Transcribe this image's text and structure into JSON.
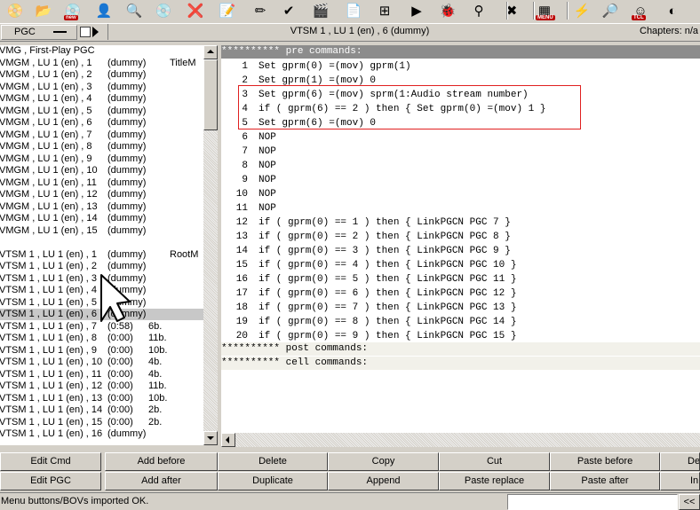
{
  "toolbar": {
    "icons": [
      {
        "name": "open-disc-icon",
        "glyph": "📀",
        "badge": ""
      },
      {
        "name": "open-folder-icon",
        "glyph": "📂",
        "badge": ""
      },
      {
        "name": "new-disc-icon",
        "glyph": "💿",
        "badge": "new"
      },
      {
        "name": "user-icon",
        "glyph": "👤",
        "badge": ""
      },
      {
        "name": "search-icon",
        "glyph": "🔍",
        "badge": ""
      },
      {
        "name": "disc-tools-icon",
        "glyph": "💿",
        "badge": ""
      },
      {
        "name": "remove-icon",
        "glyph": "❌",
        "badge": ""
      },
      {
        "name": "notepad-icon",
        "glyph": "📝",
        "badge": ""
      },
      {
        "name": "edit-icon",
        "glyph": "✏",
        "badge": ""
      },
      {
        "name": "check-disc-icon",
        "glyph": "✔",
        "badge": ""
      },
      {
        "name": "video-icon",
        "glyph": "🎬",
        "badge": ""
      },
      {
        "name": "document-icon",
        "glyph": "📄",
        "badge": ""
      },
      {
        "name": "grid-icon",
        "glyph": "⊞",
        "badge": ""
      },
      {
        "name": "play-icon",
        "glyph": "▶",
        "badge": ""
      },
      {
        "name": "bug-icon",
        "glyph": "🐞",
        "badge": ""
      },
      {
        "name": "tree-icon",
        "glyph": "⚲",
        "badge": ""
      },
      {
        "name": "delete-icon",
        "glyph": "✖",
        "badge": ""
      },
      {
        "name": "menu-icon",
        "glyph": "▦",
        "badge": "MENU"
      },
      {
        "name": "wand-icon",
        "glyph": "⚡",
        "badge": ""
      },
      {
        "name": "numbers-search-icon",
        "glyph": "🔎",
        "badge": ""
      },
      {
        "name": "tcl-icon",
        "glyph": "☺",
        "badge": "TCL"
      },
      {
        "name": "more-icon",
        "glyph": "◐",
        "badge": ""
      }
    ]
  },
  "header": {
    "pgc_label": "PGC",
    "title": "VTSM 1 , LU 1 (en) , 6  (dummy)",
    "chapters": "Chapters: n/a"
  },
  "list": {
    "items": [
      {
        "c1": "VMG , First-Play PGC",
        "c2": "",
        "c3": "",
        "c4": ""
      },
      {
        "c1": "VMGM , LU 1 (en) , 1",
        "c2": "(dummy)",
        "c3": "",
        "c4": "TitleM"
      },
      {
        "c1": "VMGM , LU 1 (en) , 2",
        "c2": "(dummy)",
        "c3": "",
        "c4": ""
      },
      {
        "c1": "VMGM , LU 1 (en) , 3",
        "c2": "(dummy)",
        "c3": "",
        "c4": ""
      },
      {
        "c1": "VMGM , LU 1 (en) , 4",
        "c2": "(dummy)",
        "c3": "",
        "c4": ""
      },
      {
        "c1": "VMGM , LU 1 (en) , 5",
        "c2": "(dummy)",
        "c3": "",
        "c4": ""
      },
      {
        "c1": "VMGM , LU 1 (en) , 6",
        "c2": "(dummy)",
        "c3": "",
        "c4": ""
      },
      {
        "c1": "VMGM , LU 1 (en) , 7",
        "c2": "(dummy)",
        "c3": "",
        "c4": ""
      },
      {
        "c1": "VMGM , LU 1 (en) , 8",
        "c2": "(dummy)",
        "c3": "",
        "c4": ""
      },
      {
        "c1": "VMGM , LU 1 (en) , 9",
        "c2": "(dummy)",
        "c3": "",
        "c4": ""
      },
      {
        "c1": "VMGM , LU 1 (en) , 10",
        "c2": "(dummy)",
        "c3": "",
        "c4": ""
      },
      {
        "c1": "VMGM , LU 1 (en) , 11",
        "c2": "(dummy)",
        "c3": "",
        "c4": ""
      },
      {
        "c1": "VMGM , LU 1 (en) , 12",
        "c2": "(dummy)",
        "c3": "",
        "c4": ""
      },
      {
        "c1": "VMGM , LU 1 (en) , 13",
        "c2": "(dummy)",
        "c3": "",
        "c4": ""
      },
      {
        "c1": "VMGM , LU 1 (en) , 14",
        "c2": "(dummy)",
        "c3": "",
        "c4": ""
      },
      {
        "c1": "VMGM , LU 1 (en) , 15",
        "c2": "(dummy)",
        "c3": "",
        "c4": ""
      },
      {
        "c1": "",
        "c2": "",
        "c3": "",
        "c4": ""
      },
      {
        "c1": "VTSM 1 , LU 1 (en) , 1",
        "c2": "(dummy)",
        "c3": "",
        "c4": "RootM"
      },
      {
        "c1": "VTSM 1 , LU 1 (en) , 2",
        "c2": "(dummy)",
        "c3": "",
        "c4": ""
      },
      {
        "c1": "VTSM 1 , LU 1 (en) , 3",
        "c2": "(dummy)",
        "c3": "",
        "c4": ""
      },
      {
        "c1": "VTSM 1 , LU 1 (en) , 4",
        "c2": "(dummy)",
        "c3": "",
        "c4": ""
      },
      {
        "c1": "VTSM 1 , LU 1 (en) , 5",
        "c2": "(dummy)",
        "c3": "",
        "c4": ""
      },
      {
        "c1": "VTSM 1 , LU 1 (en) , 6",
        "c2": "(dummy)",
        "c3": "",
        "c4": "",
        "selected": true
      },
      {
        "c1": "VTSM 1 , LU 1 (en) , 7",
        "c2": "(0:58)",
        "c3": "6b.",
        "c4": ""
      },
      {
        "c1": "VTSM 1 , LU 1 (en) , 8",
        "c2": "(0:00)",
        "c3": "11b.",
        "c4": ""
      },
      {
        "c1": "VTSM 1 , LU 1 (en) , 9",
        "c2": "(0:00)",
        "c3": "10b.",
        "c4": ""
      },
      {
        "c1": "VTSM 1 , LU 1 (en) , 10",
        "c2": "(0:00)",
        "c3": "4b.",
        "c4": ""
      },
      {
        "c1": "VTSM 1 , LU 1 (en) , 11",
        "c2": "(0:00)",
        "c3": "4b.",
        "c4": ""
      },
      {
        "c1": "VTSM 1 , LU 1 (en) , 12",
        "c2": "(0:00)",
        "c3": "11b.",
        "c4": ""
      },
      {
        "c1": "VTSM 1 , LU 1 (en) , 13",
        "c2": "(0:00)",
        "c3": "10b.",
        "c4": ""
      },
      {
        "c1": "VTSM 1 , LU 1 (en) , 14",
        "c2": "(0:00)",
        "c3": "2b.",
        "c4": ""
      },
      {
        "c1": "VTSM 1 , LU 1 (en) , 15",
        "c2": "(0:00)",
        "c3": "2b.",
        "c4": ""
      },
      {
        "c1": "VTSM 1 , LU 1 (en) , 16",
        "c2": "(dummy)",
        "c3": "",
        "c4": ""
      }
    ]
  },
  "commands": {
    "pre_header": "********** pre commands:",
    "pre": [
      {
        "n": "1",
        "t": "Set gprm(0) =(mov) gprm(1)"
      },
      {
        "n": "2",
        "t": "Set gprm(1) =(mov) 0"
      },
      {
        "n": "3",
        "t": "Set gprm(6) =(mov) sprm(1:Audio stream number)"
      },
      {
        "n": "4",
        "t": "if ( gprm(6) == 2 ) then { Set gprm(0) =(mov) 1 }"
      },
      {
        "n": "5",
        "t": "Set gprm(6) =(mov) 0"
      },
      {
        "n": "6",
        "t": "NOP"
      },
      {
        "n": "7",
        "t": "NOP"
      },
      {
        "n": "8",
        "t": "NOP"
      },
      {
        "n": "9",
        "t": "NOP"
      },
      {
        "n": "10",
        "t": "NOP"
      },
      {
        "n": "11",
        "t": "NOP"
      },
      {
        "n": "12",
        "t": "if ( gprm(0) == 1 ) then { LinkPGCN PGC 7 }"
      },
      {
        "n": "13",
        "t": "if ( gprm(0) == 2 ) then { LinkPGCN PGC 8 }"
      },
      {
        "n": "14",
        "t": "if ( gprm(0) == 3 ) then { LinkPGCN PGC 9 }"
      },
      {
        "n": "15",
        "t": "if ( gprm(0) == 4 ) then { LinkPGCN PGC 10 }"
      },
      {
        "n": "16",
        "t": "if ( gprm(0) == 5 ) then { LinkPGCN PGC 11 }"
      },
      {
        "n": "17",
        "t": "if ( gprm(0) == 6 ) then { LinkPGCN PGC 12 }"
      },
      {
        "n": "18",
        "t": "if ( gprm(0) == 7 ) then { LinkPGCN PGC 13 }"
      },
      {
        "n": "19",
        "t": "if ( gprm(0) == 8 ) then { LinkPGCN PGC 14 }"
      },
      {
        "n": "20",
        "t": "if ( gprm(0) == 9 ) then { LinkPGCN PGC 15 }"
      }
    ],
    "post_header": "********** post commands:",
    "cell_header": "********** cell commands:"
  },
  "buttons": {
    "edit_cmd": "Edit Cmd",
    "add_before": "Add before",
    "delete": "Delete",
    "copy": "Copy",
    "cut": "Cut",
    "paste_before": "Paste before",
    "de": "De",
    "edit_pgc": "Edit PGC",
    "add_after": "Add after",
    "duplicate": "Duplicate",
    "append": "Append",
    "paste_replace": "Paste replace",
    "paste_after": "Paste after",
    "in": "In"
  },
  "status": {
    "message": "Menu buttons/BOVs imported OK.",
    "input_value": "",
    "nav_button": "<<"
  },
  "colors": {
    "highlight_box": "#e02020",
    "section_header": "#8c8c8c",
    "selected_row": "#c8c8c8"
  }
}
